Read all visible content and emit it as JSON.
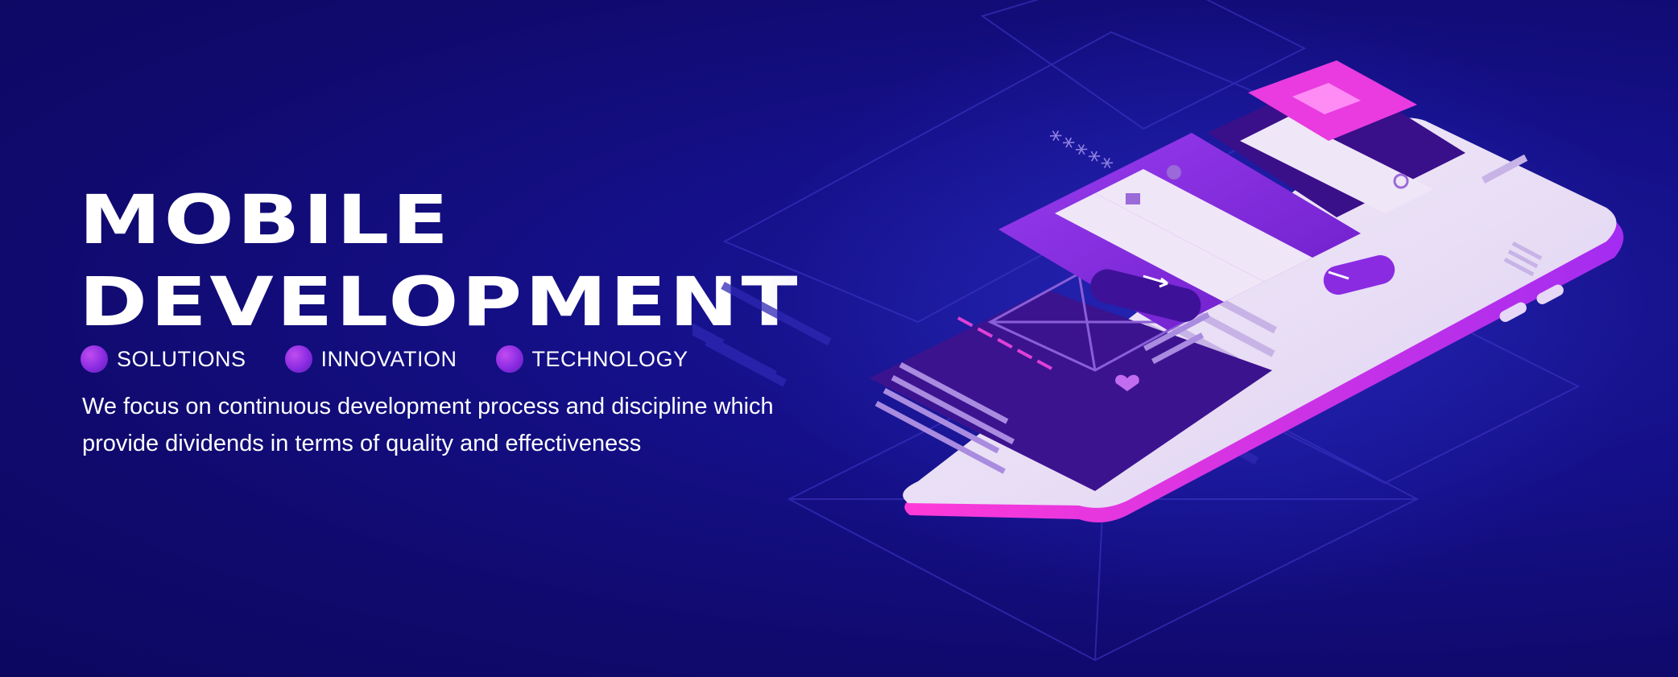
{
  "hero": {
    "title_line1": "MOBILE",
    "title_line2": "DEVELOPMENT",
    "tags": [
      "SOLUTIONS",
      "INNOVATION",
      "TECHNOLOGY"
    ],
    "description_line1": "We focus on continuous development process and discipline which",
    "description_line2": "provide dividends in terms of quality and effectiveness"
  },
  "illustration": {
    "password_mask": "*****",
    "icons": [
      "user-icon",
      "lock-icon",
      "search-icon",
      "arrow-right-icon",
      "heart-icon",
      "menu-icon"
    ]
  },
  "colors": {
    "background": "#120c78",
    "accent_purple": "#7c1fd8",
    "accent_pink": "#e040d8",
    "phone_body": "#efe6f7"
  }
}
